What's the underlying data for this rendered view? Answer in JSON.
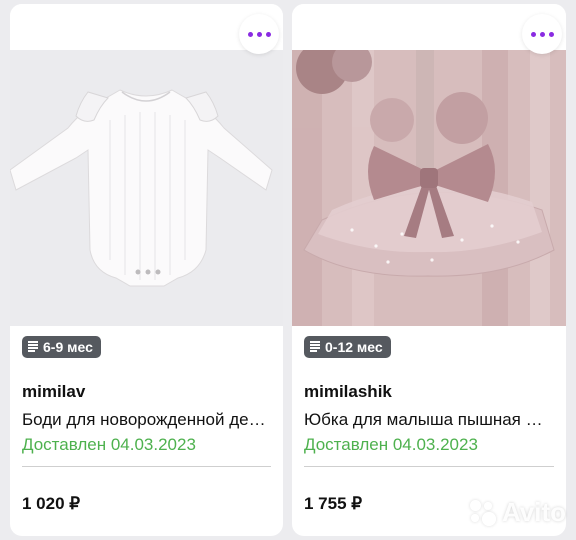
{
  "listings": [
    {
      "age_badge": "6-9 мес",
      "seller": "mimilav",
      "title": "Боди для новорожденной девочки",
      "status": "Доставлен 04.03.2023",
      "price": "1 020 ₽"
    },
    {
      "age_badge": "0-12 мес",
      "seller": "mimilashik",
      "title": "Юбка для малыша пышная фатиновая",
      "status": "Доставлен 04.03.2023",
      "price": "1 755 ₽"
    }
  ],
  "watermark": "Avito",
  "colors": {
    "accent": "#8a2be2",
    "status_green": "#4eb14e",
    "badge_bg": "#55595f"
  }
}
